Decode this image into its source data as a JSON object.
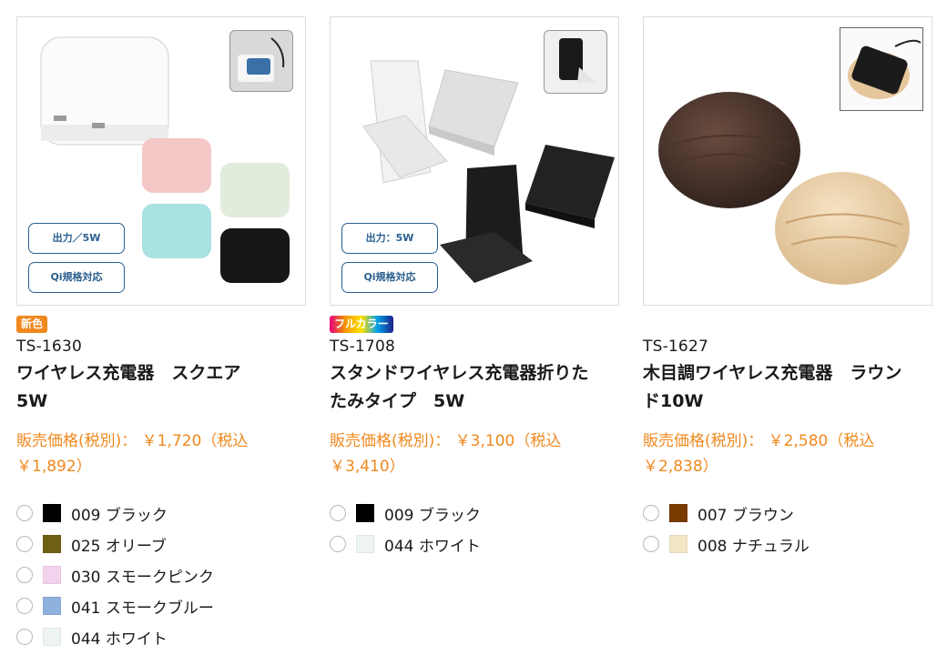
{
  "products": [
    {
      "badge": "新色",
      "code": "TS-1630",
      "name_line1": "ワイヤレス充電器　スクエア",
      "name_line2": "5W",
      "price_line1": "販売価格(税別)： ￥1,720（税込",
      "price_line2": "￥1,892）",
      "tags": [
        "出力／5W",
        "Qi規格対応"
      ],
      "colors": [
        {
          "label": "009 ブラック",
          "hex": "#000000"
        },
        {
          "label": "025 オリーブ",
          "hex": "#6e5f14"
        },
        {
          "label": "030 スモークピンク",
          "hex": "#f2d2ec"
        },
        {
          "label": "041 スモークブルー",
          "hex": "#8eb0dc"
        },
        {
          "label": "044 ホワイト",
          "hex": "#eef3f3"
        }
      ]
    },
    {
      "badge": "フルカラー",
      "code": "TS-1708",
      "name_line1": "スタンドワイヤレス充電器折りた",
      "name_line2": "たみタイプ　5W",
      "price_line1": "販売価格(税別)： ￥3,100（税込",
      "price_line2": "￥3,410）",
      "tags": [
        "出力：5W",
        "Qi規格対応"
      ],
      "colors": [
        {
          "label": "009 ブラック",
          "hex": "#000000"
        },
        {
          "label": "044 ホワイト",
          "hex": "#eef3f3"
        }
      ]
    },
    {
      "badge": "",
      "code": "TS-1627",
      "name_line1": "木目調ワイヤレス充電器　ラウン",
      "name_line2": "ド10W",
      "price_line1": "販売価格(税別)： ￥2,580（税込",
      "price_line2": "￥2,838）",
      "tags": [],
      "colors": [
        {
          "label": "007 ブラウン",
          "hex": "#7a3b00"
        },
        {
          "label": "008 ナチュラル",
          "hex": "#f1e5c6"
        }
      ]
    }
  ]
}
